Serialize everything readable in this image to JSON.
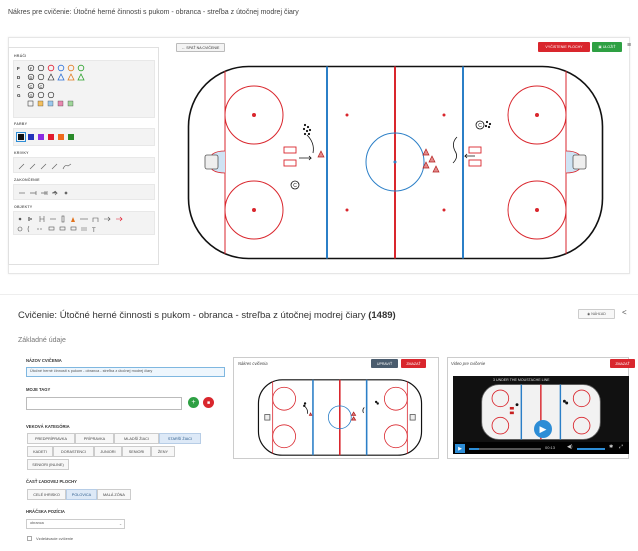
{
  "top": {
    "title": "Nákres pre cvičenie: Útočné herné činnosti s pukom - obranca - streľba z útočnej modrej čiary"
  },
  "editor": {
    "back_label": "← SPÄŤ NA CVIČENIE",
    "clear_label": "VYČISTENIE PLOCHY",
    "save_label": "ULOŽIŤ",
    "menu_icon": "≡",
    "sections": {
      "players": "HRÁČI",
      "colors": "FARBY",
      "curves": "KRIVKY",
      "endings": "ZAKONČENIE",
      "objects": "OBJEKTY"
    },
    "player_rows": [
      "F",
      "D",
      "C",
      "G"
    ],
    "palette": [
      "#111111",
      "#2233bb",
      "#8a2be2",
      "#e2192d",
      "#ee6a1c",
      "#2a8a2a"
    ],
    "rink_symbols": {
      "c_left": "C",
      "c_right": "C"
    }
  },
  "main": {
    "title": "Cvičenie: Útočné herné činnosti s pukom - obranca - streľba z útočnej modrej čiary",
    "id": "(1489)",
    "preview_label": "NÁHĽAD",
    "share_icon": "share-icon",
    "subtitle": "Základné údaje",
    "name_label": "NÁZOV CVIČENIA",
    "name_value": "Útočné herné činnosti s pukom - obranca - streľba z útočnej modrej čiary",
    "tags_label": "MOJE TAGY",
    "age_label": "VEKOVÁ KATEGÓRIA",
    "age_row1": [
      "PREDPRÍPRAVKA",
      "PRÍPRAVKA",
      "MLADŠÍ ŽIACI",
      "STARŠÍ ŽIACI"
    ],
    "age_row2": [
      "KADETI",
      "DORASTENCI",
      "JUNIORI",
      "SENIORI",
      "ŽENY"
    ],
    "age_row3": [
      "SENIORI (INLINE)"
    ],
    "ice_label": "ČASŤ ĽADOVEJ PLOCHY",
    "ice_options": [
      "CELÉ IHRISKO",
      "POLOVICA",
      "MALÁ ZÓNA"
    ],
    "position_label": "HRÁČSKA POZÍCIA",
    "position_value": "obranca",
    "education_label": "Vzdelávacie cvičenie",
    "drawing_panel": {
      "title": "Nákres cvičenia",
      "edit": "UPRAVIŤ",
      "delete": "ZMAZAŤ"
    },
    "video_panel": {
      "title": "Video pre cvičenie",
      "delete": "ZMAZAŤ",
      "video_title": "3 UNDER THE MOUSTACHE LINE",
      "time": "00:13"
    }
  },
  "colors": {
    "red": "#d9262d",
    "green": "#2ea043",
    "blue_line": "#2b7fc7",
    "rink_red": "#d9262d",
    "accent": "#2d8dd6"
  }
}
